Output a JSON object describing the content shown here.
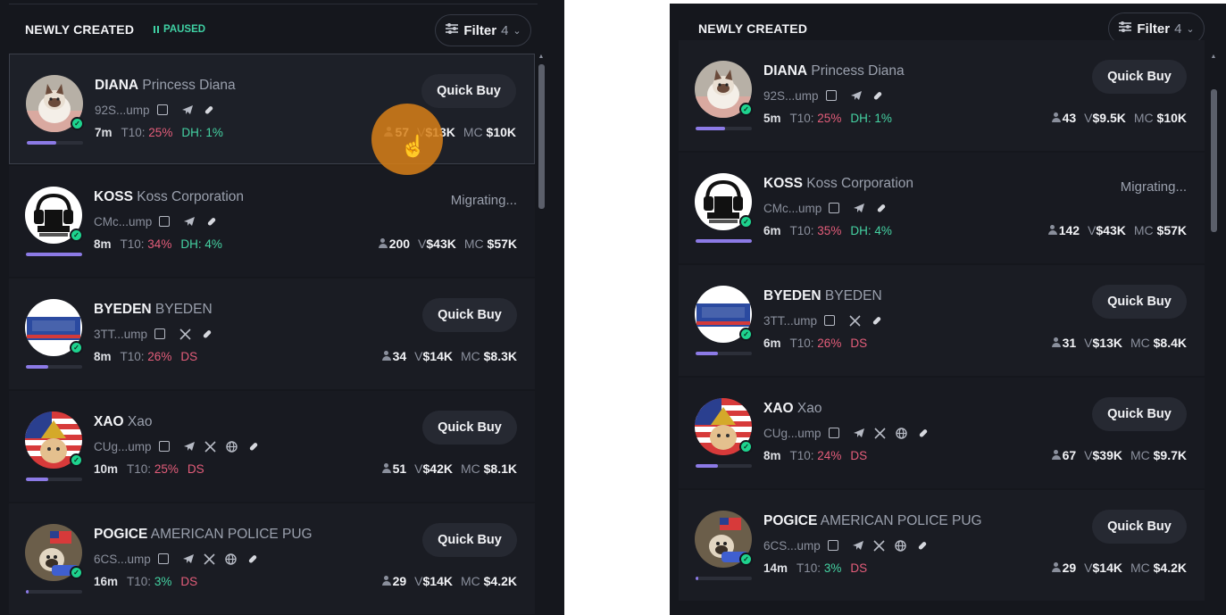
{
  "colors": {
    "paused": "#3fd1a4",
    "accent_progress": "#8c7ae6",
    "red": "#e45d7a",
    "green": "#45d3a3",
    "cursor_halo": "#d88018"
  },
  "left": {
    "header": {
      "title": "NEWLY CREATED",
      "status": "PAUSED",
      "filter_label": "Filter",
      "filter_count": "4"
    },
    "tokens": [
      {
        "ticker": "DIANA",
        "name": "Princess Diana",
        "addr": "92S...ump",
        "age": "7m",
        "t10": "25%",
        "extra_label": "DH:",
        "extra_value": "1%",
        "holders": "57",
        "volume": "$13K",
        "mcap": "$10K",
        "action": "Quick Buy",
        "progress": 0.52,
        "socials": [
          "telegram",
          "pill"
        ]
      },
      {
        "ticker": "KOSS",
        "name": "Koss Corporation",
        "addr": "CMc...ump",
        "age": "8m",
        "t10": "34%",
        "extra_label": "DH:",
        "extra_value": "4%",
        "holders": "200",
        "volume": "$43K",
        "mcap": "$57K",
        "action": "Migrating...",
        "progress": 1.0,
        "socials": [
          "telegram",
          "pill"
        ]
      },
      {
        "ticker": "BYEDEN",
        "name": "BYEDEN",
        "addr": "3TT...ump",
        "age": "8m",
        "t10": "26%",
        "extra_label": "DS",
        "extra_value": "",
        "holders": "34",
        "volume": "$14K",
        "mcap": "$8.3K",
        "action": "Quick Buy",
        "progress": 0.4,
        "socials": [
          "x",
          "pill"
        ]
      },
      {
        "ticker": "XAO",
        "name": "Xao",
        "addr": "CUg...ump",
        "age": "10m",
        "t10": "25%",
        "extra_label": "DS",
        "extra_value": "",
        "holders": "51",
        "volume": "$42K",
        "mcap": "$8.1K",
        "action": "Quick Buy",
        "progress": 0.4,
        "socials": [
          "telegram",
          "x",
          "globe",
          "pill"
        ]
      },
      {
        "ticker": "POGICE",
        "name": "AMERICAN POLICE PUG",
        "addr": "6CS...ump",
        "age": "16m",
        "t10": "3%",
        "extra_label": "DS",
        "extra_value": "",
        "holders": "29",
        "volume": "$14K",
        "mcap": "$4.2K",
        "action": "Quick Buy",
        "progress": 0.05,
        "socials": [
          "telegram",
          "x",
          "globe",
          "pill"
        ]
      }
    ]
  },
  "right": {
    "header": {
      "title": "NEWLY CREATED",
      "filter_label": "Filter",
      "filter_count": "4"
    },
    "tokens": [
      {
        "ticker": "DIANA",
        "name": "Princess Diana",
        "addr": "92S...ump",
        "age": "5m",
        "t10": "25%",
        "extra_label": "DH:",
        "extra_value": "1%",
        "holders": "43",
        "volume": "$9.5K",
        "mcap": "$10K",
        "action": "Quick Buy",
        "progress": 0.52,
        "socials": [
          "telegram",
          "pill"
        ]
      },
      {
        "ticker": "KOSS",
        "name": "Koss Corporation",
        "addr": "CMc...ump",
        "age": "6m",
        "t10": "35%",
        "extra_label": "DH:",
        "extra_value": "4%",
        "holders": "142",
        "volume": "$43K",
        "mcap": "$57K",
        "action": "Migrating...",
        "progress": 1.0,
        "socials": [
          "telegram",
          "pill"
        ]
      },
      {
        "ticker": "BYEDEN",
        "name": "BYEDEN",
        "addr": "3TT...ump",
        "age": "6m",
        "t10": "26%",
        "extra_label": "DS",
        "extra_value": "",
        "holders": "31",
        "volume": "$13K",
        "mcap": "$8.4K",
        "action": "Quick Buy",
        "progress": 0.4,
        "socials": [
          "x",
          "pill"
        ]
      },
      {
        "ticker": "XAO",
        "name": "Xao",
        "addr": "CUg...ump",
        "age": "8m",
        "t10": "24%",
        "extra_label": "DS",
        "extra_value": "",
        "holders": "67",
        "volume": "$39K",
        "mcap": "$9.7K",
        "action": "Quick Buy",
        "progress": 0.4,
        "socials": [
          "telegram",
          "x",
          "globe",
          "pill"
        ]
      },
      {
        "ticker": "POGICE",
        "name": "AMERICAN POLICE PUG",
        "addr": "6CS...ump",
        "age": "14m",
        "t10": "3%",
        "extra_label": "DS",
        "extra_value": "",
        "holders": "29",
        "volume": "$14K",
        "mcap": "$4.2K",
        "action": "Quick Buy",
        "progress": 0.05,
        "socials": [
          "telegram",
          "x",
          "globe",
          "pill"
        ]
      }
    ]
  },
  "labels": {
    "t10": "T10:",
    "volume": "V",
    "mcap": "MC"
  }
}
